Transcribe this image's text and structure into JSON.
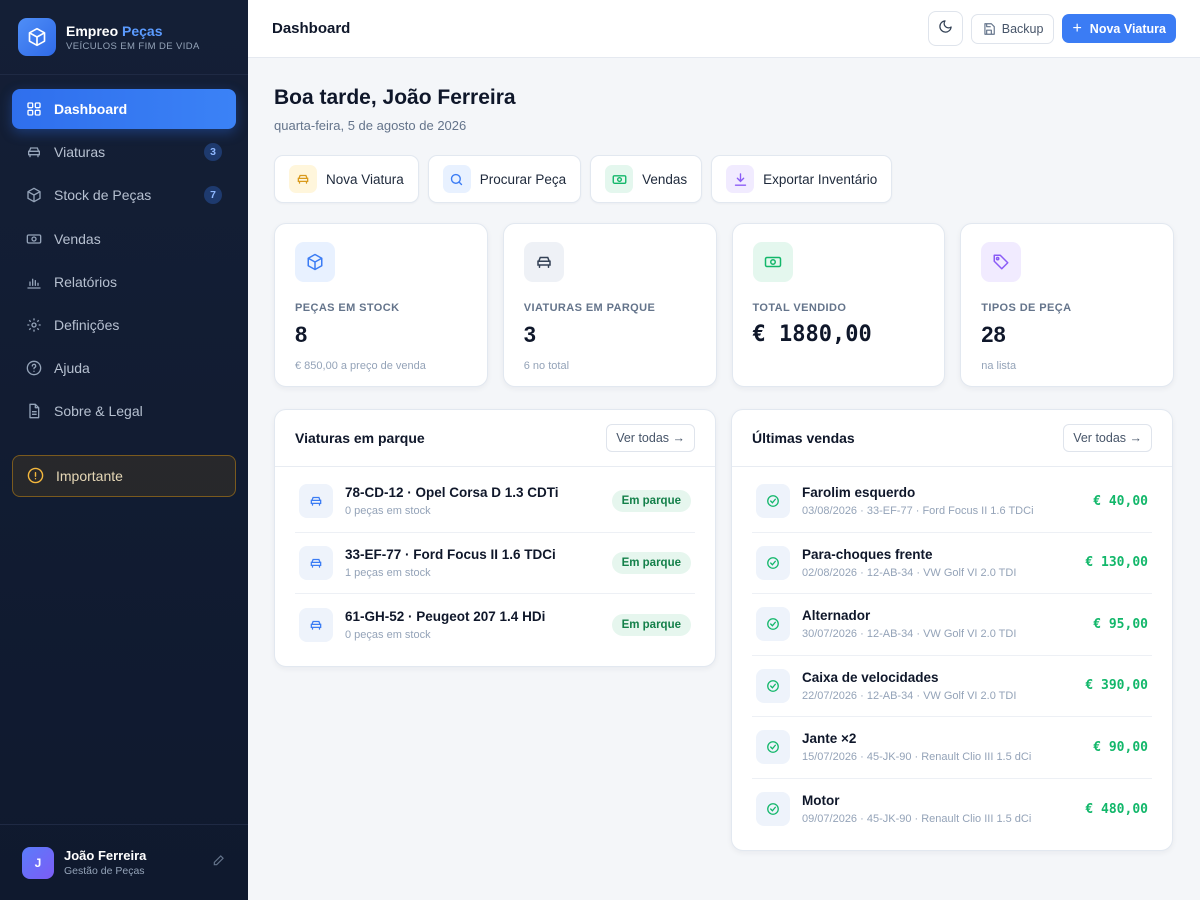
{
  "brand": {
    "name_a": "Empreo",
    "name_b": "Peças",
    "subtitle": "VEÍCULOS EM FIM DE VIDA"
  },
  "sidebar": {
    "items": [
      {
        "label": "Dashboard",
        "icon": "grid-icon",
        "active": true
      },
      {
        "label": "Viaturas",
        "icon": "car-icon",
        "badge": "3"
      },
      {
        "label": "Stock de Peças",
        "icon": "box-icon",
        "badge": "7"
      },
      {
        "label": "Vendas",
        "icon": "cash-icon"
      },
      {
        "label": "Relatórios",
        "icon": "bar-chart-icon"
      },
      {
        "label": "Definições",
        "icon": "gear-icon"
      },
      {
        "label": "Ajuda",
        "icon": "help-icon"
      },
      {
        "label": "Sobre & Legal",
        "icon": "document-icon"
      }
    ],
    "important": "Importante"
  },
  "user": {
    "initial": "J",
    "name": "João Ferreira",
    "role": "Gestão de Peças"
  },
  "topbar": {
    "title": "Dashboard",
    "backup": "Backup",
    "new_vehicle": "Nova Viatura"
  },
  "main": {
    "greeting": "Boa tarde, João Ferreira",
    "date": "quarta-feira, 5 de agosto de 2026",
    "quick_actions": [
      "Nova Viatura",
      "Procurar Peça",
      "Vendas",
      "Exportar Inventário"
    ]
  },
  "stats": [
    {
      "label": "PEÇAS EM STOCK",
      "value": "8",
      "sub": "€ 850,00 a preço de venda"
    },
    {
      "label": "VIATURAS EM PARQUE",
      "value": "3",
      "sub": "6 no total"
    },
    {
      "label": "TOTAL VENDIDO",
      "value": "€ 1880,00",
      "sub": ""
    },
    {
      "label": "TIPOS DE PEÇA",
      "value": "28",
      "sub": "na lista"
    }
  ],
  "vehicles_panel": {
    "title": "Viaturas em parque",
    "see_all": "Ver todas →",
    "rows": [
      {
        "title": "78-CD-12 · Opel Corsa D 1.3 CDTi",
        "sub": "0 peças em stock",
        "status": "Em parque"
      },
      {
        "title": "33-EF-77 · Ford Focus II 1.6 TDCi",
        "sub": "1 peças em stock",
        "status": "Em parque"
      },
      {
        "title": "61-GH-52 · Peugeot 207 1.4 HDi",
        "sub": "0 peças em stock",
        "status": "Em parque"
      }
    ]
  },
  "sales_panel": {
    "title": "Últimas vendas",
    "see_all": "Ver todas →",
    "rows": [
      {
        "title": "Farolim esquerdo",
        "sub": "03/08/2026 · 33-EF-77 · Ford Focus II 1.6 TDCi",
        "amount": "€ 40,00"
      },
      {
        "title": "Para-choques frente",
        "sub": "02/08/2026 · 12-AB-34 · VW Golf VI 2.0 TDI",
        "amount": "€ 130,00"
      },
      {
        "title": "Alternador",
        "sub": "30/07/2026 · 12-AB-34 · VW Golf VI 2.0 TDI",
        "amount": "€ 95,00"
      },
      {
        "title": "Caixa de velocidades",
        "sub": "22/07/2026 · 12-AB-34 · VW Golf VI 2.0 TDI",
        "amount": "€ 390,00"
      },
      {
        "title": "Jante ×2",
        "sub": "15/07/2026 · 45-JK-90 · Renault Clio III 1.5 dCi",
        "amount": "€ 90,00"
      },
      {
        "title": "Motor",
        "sub": "09/07/2026 · 45-JK-90 · Renault Clio III 1.5 dCi",
        "amount": "€ 480,00"
      }
    ]
  },
  "colors": {
    "accent": "#3b7cf4",
    "success": "#12b76a",
    "sidebar_bg": "#141f36"
  }
}
